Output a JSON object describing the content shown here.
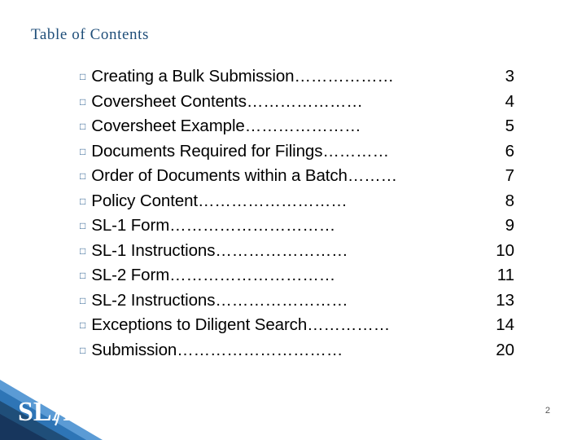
{
  "slide": {
    "title": "Table of Contents",
    "number": "2",
    "accent_color": "#1f4e79",
    "bullet_glyph": "□"
  },
  "toc": {
    "items": [
      {
        "label": "Creating a Bulk Submission………………",
        "page": "3"
      },
      {
        "label": "Coversheet Contents…………………",
        "page": "4"
      },
      {
        "label": "Coversheet Example…………………",
        "page": "5"
      },
      {
        "label": "Documents Required for Filings…………",
        "page": "6"
      },
      {
        "label": "Order of Documents within a Batch………",
        "page": "7"
      },
      {
        "label": "Policy Content………………………",
        "page": "8"
      },
      {
        "label": "SL-1 Form…………………………",
        "page": "9"
      },
      {
        "label": "SL-1 Instructions……………………",
        "page": "10"
      },
      {
        "label": "SL-2 Form…………………………",
        "page": "11"
      },
      {
        "label": "SL-2 Instructions……………………",
        "page": "13"
      },
      {
        "label": "Exceptions to Diligent Search……………",
        "page": "14"
      },
      {
        "label": "Submission…………………………",
        "page": "20"
      }
    ]
  },
  "logo": {
    "text": "SLA"
  }
}
